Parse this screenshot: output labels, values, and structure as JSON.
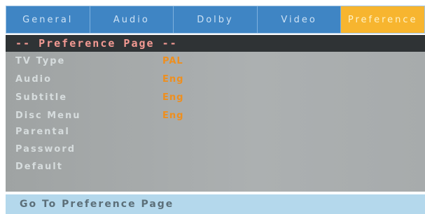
{
  "tabs": [
    {
      "label": "General"
    },
    {
      "label": "Audio"
    },
    {
      "label": "Dolby"
    },
    {
      "label": "Video"
    },
    {
      "label": "Preference",
      "active": true
    }
  ],
  "page_title": "-- Preference Page --",
  "settings": [
    {
      "label": "TV Type",
      "value": "PAL"
    },
    {
      "label": "Audio",
      "value": "Eng"
    },
    {
      "label": "Subtitle",
      "value": "Eng"
    },
    {
      "label": "Disc Menu",
      "value": "Eng"
    },
    {
      "label": "Parental",
      "value": ""
    },
    {
      "label": "Password",
      "value": ""
    },
    {
      "label": "Default",
      "value": ""
    }
  ],
  "status_text": "Go To Preference Page",
  "colors": {
    "tab_background": "#3f85c4",
    "active_tab": "#f7b52f",
    "title_bar": "#2f3335",
    "title_text": "#f39a93",
    "panel": "#a7abac",
    "value_text": "#ee8f1f",
    "status_bar": "#b4d8ec"
  }
}
